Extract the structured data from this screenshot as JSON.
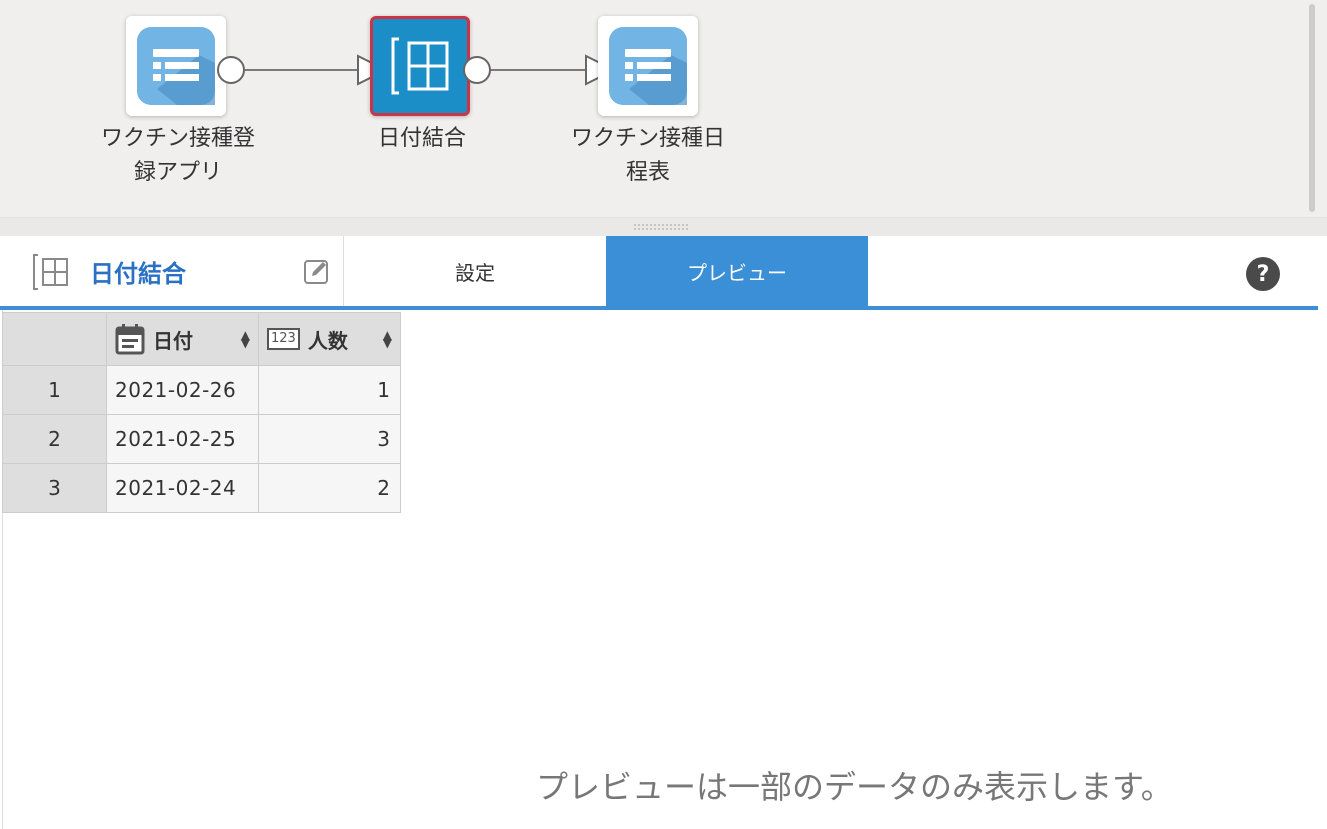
{
  "flow": {
    "nodes": [
      {
        "label_line1": "ワクチン接種登",
        "label_line2": "録アプリ",
        "icon": "table-list-icon"
      },
      {
        "label_line1": "日付結合",
        "label_line2": "",
        "icon": "join-grid-icon"
      },
      {
        "label_line1": "ワクチン接種日",
        "label_line2": "程表",
        "icon": "table-list-icon"
      }
    ]
  },
  "panel": {
    "title": "日付結合",
    "tabs": {
      "settings": "設定",
      "preview": "プレビュー"
    },
    "help_glyph": "?"
  },
  "table": {
    "columns": [
      {
        "label": "日付",
        "type_icon": "calendar-icon"
      },
      {
        "label": "人数",
        "type_icon": "number-123-icon",
        "badge": "123"
      }
    ],
    "rows": [
      {
        "n": "1",
        "date": "2021-02-26",
        "count": "1"
      },
      {
        "n": "2",
        "date": "2021-02-25",
        "count": "3"
      },
      {
        "n": "3",
        "date": "2021-02-24",
        "count": "2"
      }
    ]
  },
  "note": "プレビューは一部のデータのみ表示します。",
  "colors": {
    "accent": "#3a8fd6",
    "title": "#2a71c4",
    "selected_node": "#1b8ec7",
    "selected_border": "#cc3344"
  }
}
